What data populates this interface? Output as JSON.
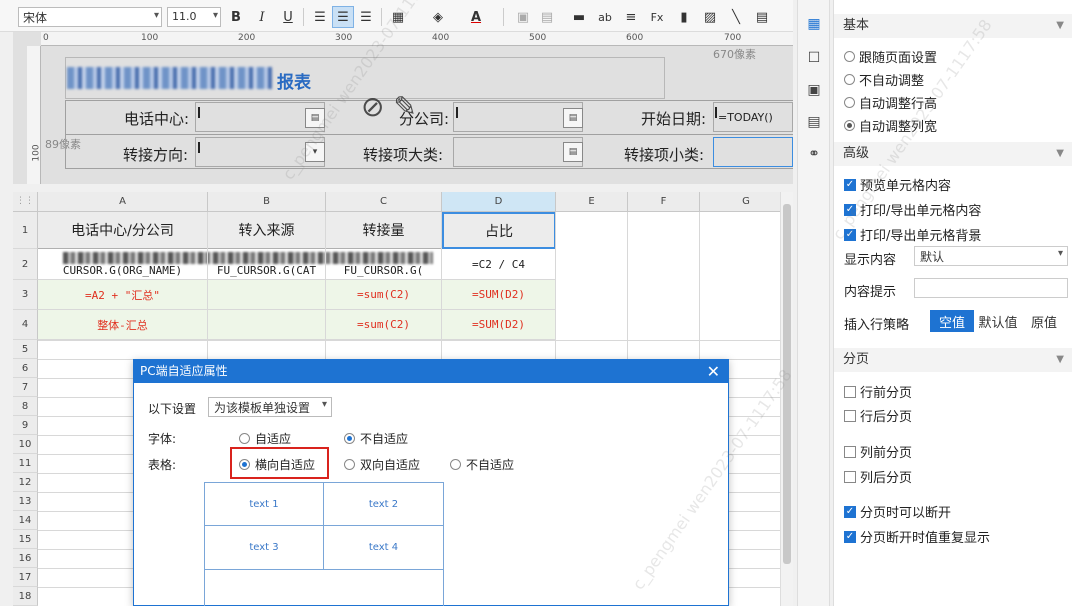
{
  "toolbar": {
    "font_name": "宋体",
    "font_size": "11.0"
  },
  "design": {
    "ruler_h": [
      "0",
      "100",
      "200",
      "300",
      "400",
      "500",
      "600",
      "700"
    ],
    "ruler_v": [
      "100"
    ],
    "note_670": "670像素",
    "note_89": "89像素",
    "title": "报表",
    "params": {
      "center": "电话中心:",
      "branch": "分公司:",
      "start": "开始日期:",
      "direction": "转接方向:",
      "major": "转接项大类:",
      "minor": "转接项小类:"
    },
    "today": "=TODAY()"
  },
  "sheet": {
    "columns": [
      "A",
      "B",
      "C",
      "D",
      "E",
      "F",
      "G"
    ],
    "rows": [
      "1",
      "2",
      "3",
      "4",
      "5",
      "6",
      "7",
      "8",
      "9",
      "10",
      "11",
      "12",
      "13",
      "14",
      "15",
      "16",
      "17",
      "18"
    ],
    "header": [
      "电话中心/分公司",
      "转入来源",
      "转接量",
      "占比"
    ],
    "row2": [
      "CURSOR.G(ORG_NAME)",
      "FU_CURSOR.G(CAT",
      "FU_CURSOR.G(",
      "=C2 / C4"
    ],
    "row3": [
      "=A2 + \"汇总\"",
      "",
      "=sum(C2)",
      "=SUM(D2)"
    ],
    "row4": [
      "整体-汇总",
      "",
      "=sum(C2)",
      "=SUM(D2)"
    ]
  },
  "dialog": {
    "title": "PC端自适应属性",
    "setting_label": "以下设置",
    "setting_value": "为该模板单独设置",
    "font_label": "字体:",
    "table_label": "表格:",
    "font_opts": [
      "自适应",
      "不自适应"
    ],
    "table_opts": [
      "横向自适应",
      "双向自适应",
      "不自适应"
    ],
    "preview": [
      "text 1",
      "text 2",
      "text 3",
      "text 4"
    ]
  },
  "panel": {
    "basic": "基本",
    "basic_opts": [
      "跟随页面设置",
      "不自动调整",
      "自动调整行高",
      "自动调整列宽"
    ],
    "advanced": "高级",
    "adv_checks": [
      "预览单元格内容",
      "打印/导出单元格内容",
      "打印/导出单元格背景"
    ],
    "display_label": "显示内容",
    "display_value": "默认",
    "hint_label": "内容提示",
    "insert_label": "插入行策略",
    "insert_opts": [
      "空值",
      "默认值",
      "原值"
    ],
    "paging": "分页",
    "paging_opts": [
      "行前分页",
      "行后分页",
      "列前分页",
      "列后分页"
    ],
    "paging_checks": [
      "分页时可以断开",
      "分页断开时值重复显示"
    ]
  },
  "watermark": "c_pengmei wen2023-07-1117:58",
  "colors": {
    "accent": "#1e73d2",
    "highlight": "#d9231d",
    "formula": "#e03020"
  }
}
